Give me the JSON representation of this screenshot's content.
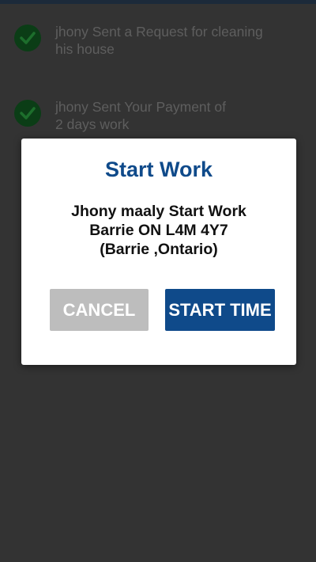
{
  "feed": {
    "items": [
      {
        "text_line1": "jhony Sent a Request for cleaning",
        "text_line2": "his house",
        "icon": "check-circle-icon"
      },
      {
        "text_line1": "jhony Sent Your Payment of",
        "text_line2": "2 days work",
        "icon": "check-circle-icon"
      }
    ]
  },
  "dialog": {
    "title": "Start Work",
    "line1": "Jhony maaly Start Work",
    "line2": "Barrie ON L4M 4Y7",
    "line3": "(Barrie ,Ontario)",
    "cancel_label": "CANCEL",
    "start_label": "START TIME"
  },
  "colors": {
    "accent": "#0f4a8a",
    "cancel_button": "#bdbdbd",
    "dim_background": "#333333",
    "check_icon": "#0b3d16"
  }
}
